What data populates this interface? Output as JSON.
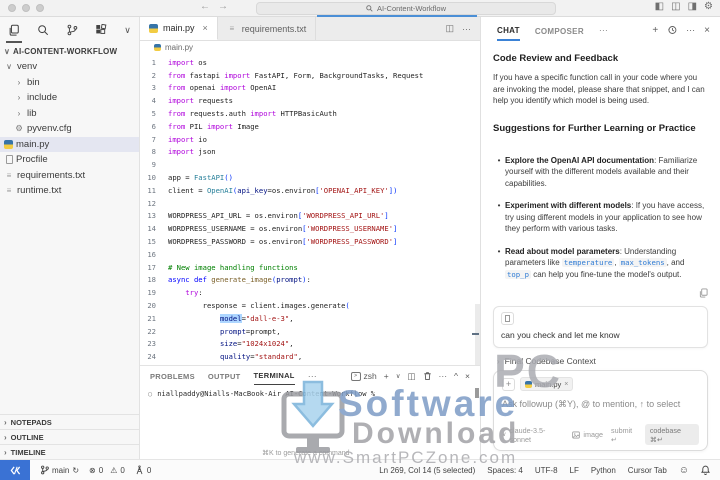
{
  "title_bar": {
    "search_value": "AI-Content-Workflow"
  },
  "icons": {
    "back": "←",
    "forward": "→",
    "panel_left": "◧",
    "panel_bottom": "◫",
    "panel_right": "◨",
    "settings": "⚙",
    "chevron_down": "∨",
    "chevron_right": "›",
    "more": "···",
    "close": "×",
    "plus": "+",
    "split": "◫",
    "caret_up": "^",
    "gear": "⚙",
    "txt_file": "≡",
    "sync": "↻",
    "error": "⊗",
    "warning": "⚠",
    "smiley": "☺",
    "prompt_circle": "○",
    "bullet": "•",
    "enter": "↵",
    "cmd_enter": "⌘↵",
    "shell_glyph": ">"
  },
  "explorer": {
    "root_label": "AI-CONTENT-WORKFLOW",
    "items": [
      {
        "label": "venv",
        "level": 1,
        "chevron": "down"
      },
      {
        "label": "bin",
        "level": 2,
        "chevron": "right"
      },
      {
        "label": "include",
        "level": 2,
        "chevron": "right"
      },
      {
        "label": "lib",
        "level": 2,
        "chevron": "right"
      },
      {
        "label": "pyvenv.cfg",
        "level": 2,
        "icon": "gear"
      },
      {
        "label": "main.py",
        "level": 1,
        "icon": "python",
        "selected": true
      },
      {
        "label": "Procfile",
        "level": 1,
        "icon": "file"
      },
      {
        "label": "requirements.txt",
        "level": 1,
        "icon": "txt"
      },
      {
        "label": "runtime.txt",
        "level": 1,
        "icon": "txt"
      }
    ],
    "bottom_sections": [
      "NOTEPADS",
      "OUTLINE",
      "TIMELINE"
    ]
  },
  "editor": {
    "tabs": [
      {
        "label": "main.py",
        "active": true
      },
      {
        "label": "requirements.txt",
        "active": false
      }
    ],
    "breadcrumb": "main.py",
    "code_lines": [
      {
        "n": 1,
        "tk": [
          [
            "kw",
            "import"
          ],
          [
            "pl",
            " os"
          ]
        ]
      },
      {
        "n": 2,
        "tk": [
          [
            "kw",
            "from"
          ],
          [
            "pl",
            " fastapi "
          ],
          [
            "kw",
            "import"
          ],
          [
            "pl",
            " FastAPI, Form, BackgroundTasks, Request"
          ]
        ]
      },
      {
        "n": 3,
        "tk": [
          [
            "kw",
            "from"
          ],
          [
            "pl",
            " openai "
          ],
          [
            "kw",
            "import"
          ],
          [
            "pl",
            " OpenAI"
          ]
        ]
      },
      {
        "n": 4,
        "tk": [
          [
            "kw",
            "import"
          ],
          [
            "pl",
            " requests"
          ]
        ]
      },
      {
        "n": 5,
        "tk": [
          [
            "kw",
            "from"
          ],
          [
            "pl",
            " requests.auth "
          ],
          [
            "kw",
            "import"
          ],
          [
            "pl",
            " HTTPBasicAuth"
          ]
        ]
      },
      {
        "n": 6,
        "tk": [
          [
            "kw",
            "from"
          ],
          [
            "pl",
            " PIL "
          ],
          [
            "kw",
            "import"
          ],
          [
            "pl",
            " Image"
          ]
        ]
      },
      {
        "n": 7,
        "tk": [
          [
            "kw",
            "import"
          ],
          [
            "pl",
            " io"
          ]
        ]
      },
      {
        "n": 8,
        "tk": [
          [
            "kw",
            "import"
          ],
          [
            "pl",
            " json"
          ]
        ]
      },
      {
        "n": 9,
        "tk": []
      },
      {
        "n": 10,
        "tk": [
          [
            "pl",
            "app = "
          ],
          [
            "cls",
            "FastAPI"
          ],
          [
            "br",
            "()"
          ]
        ]
      },
      {
        "n": 11,
        "tk": [
          [
            "pl",
            "client = "
          ],
          [
            "cls",
            "OpenAI"
          ],
          [
            "br",
            "("
          ],
          [
            "prm",
            "api_key"
          ],
          [
            "pl",
            "=os.environ"
          ],
          [
            "br",
            "["
          ],
          [
            "str",
            "'OPENAI_API_KEY'"
          ],
          [
            "br",
            "]"
          ],
          [
            "br",
            ")"
          ]
        ]
      },
      {
        "n": 12,
        "tk": []
      },
      {
        "n": 13,
        "tk": [
          [
            "pl",
            "WORDPRESS_API_URL = os.environ"
          ],
          [
            "br",
            "["
          ],
          [
            "str",
            "'WORDPRESS_API_URL'"
          ],
          [
            "br",
            "]"
          ]
        ]
      },
      {
        "n": 14,
        "tk": [
          [
            "pl",
            "WORDPRESS_USERNAME = os.environ"
          ],
          [
            "br",
            "["
          ],
          [
            "str",
            "'WORDPRESS_USERNAME'"
          ],
          [
            "br",
            "]"
          ]
        ]
      },
      {
        "n": 15,
        "tk": [
          [
            "pl",
            "WORDPRESS_PASSWORD = os.environ"
          ],
          [
            "br",
            "["
          ],
          [
            "str",
            "'WORDPRESS_PASSWORD'"
          ],
          [
            "br",
            "]"
          ]
        ]
      },
      {
        "n": 16,
        "tk": []
      },
      {
        "n": 17,
        "tk": [
          [
            "com",
            "# New image handling functions"
          ]
        ]
      },
      {
        "n": 18,
        "tk": [
          [
            "kwb",
            "async def"
          ],
          [
            "fn",
            " generate_image"
          ],
          [
            "br",
            "("
          ],
          [
            "prm",
            "prompt"
          ],
          [
            "br",
            ")"
          ],
          [
            "pl",
            ":"
          ]
        ]
      },
      {
        "n": 19,
        "tk": [
          [
            "pl",
            "    "
          ],
          [
            "kw",
            "try"
          ],
          [
            "pl",
            ":"
          ]
        ]
      },
      {
        "n": 20,
        "tk": [
          [
            "pl",
            "        response = client.images.generate"
          ],
          [
            "br",
            "("
          ]
        ]
      },
      {
        "n": 21,
        "tk": [
          [
            "pl",
            "            "
          ],
          [
            "prmsel",
            "model"
          ],
          [
            "pl",
            "="
          ],
          [
            "str",
            "\"dall-e-3\""
          ],
          [
            "pl",
            ","
          ]
        ]
      },
      {
        "n": 22,
        "tk": [
          [
            "pl",
            "            "
          ],
          [
            "prm",
            "prompt"
          ],
          [
            "pl",
            "=prompt,"
          ]
        ]
      },
      {
        "n": 23,
        "tk": [
          [
            "pl",
            "            "
          ],
          [
            "prm",
            "size"
          ],
          [
            "pl",
            "="
          ],
          [
            "str",
            "\"1024x1024\""
          ],
          [
            "pl",
            ","
          ]
        ]
      },
      {
        "n": 24,
        "tk": [
          [
            "pl",
            "            "
          ],
          [
            "prm",
            "quality"
          ],
          [
            "pl",
            "="
          ],
          [
            "str",
            "\"standard\""
          ],
          [
            "pl",
            ","
          ]
        ]
      }
    ]
  },
  "terminal": {
    "tabs": [
      {
        "label": "PROBLEMS",
        "active": false
      },
      {
        "label": "OUTPUT",
        "active": false
      },
      {
        "label": "TERMINAL",
        "active": true
      }
    ],
    "shell_label": "zsh",
    "prompt": "niallpaddy@Nialls-MacBook-Air AI-Content-Workflow %",
    "hint": "⌘K to generate a command"
  },
  "chat": {
    "tabs": [
      {
        "label": "CHAT",
        "active": true
      },
      {
        "label": "COMPOSER",
        "active": false
      }
    ],
    "message": {
      "heading1": "Code Review and Feedback",
      "para": "If you have a specific function call in your code where you are invoking the model, please share that snippet, and I can help you identify which model is being used.",
      "heading2": "Suggestions for Further Learning or Practice",
      "bullets": [
        {
          "segments": [
            {
              "b": "Explore the OpenAI API documentation"
            },
            {
              "t": ": Familiarize yourself with the different models available and their capabilities."
            }
          ]
        },
        {
          "segments": [
            {
              "b": "Experiment with different models"
            },
            {
              "t": ": If you have access, try using different models in your application to see how they perform with various tasks."
            }
          ]
        },
        {
          "segments": [
            {
              "b": "Read about model parameters"
            },
            {
              "t": ": Understanding parameters like "
            },
            {
              "c": "temperature"
            },
            {
              "t": ", "
            },
            {
              "c": "max_tokens"
            },
            {
              "t": ", and "
            },
            {
              "c": "top_p"
            },
            {
              "t": " can help you fine-tune the model's output."
            }
          ]
        }
      ]
    },
    "user_message": "can you check and let me know",
    "context_label": "Final Codebase Context",
    "input": {
      "chip_label": "main.py",
      "placeholder": "Ask followup (⌘Y), @ to mention, ↑ to select",
      "model": "claude-3.5-sonnet",
      "image_label": "image",
      "submit_label": "submit",
      "submit_key": "↵",
      "codebase_label": "codebase",
      "codebase_key": "⌘↵"
    }
  },
  "status_bar": {
    "branch": "main",
    "errors": "0",
    "warnings": "0",
    "ports": "0",
    "cursor": "Ln 269, Col 14 (5 selected)",
    "spaces": "Spaces: 4",
    "encoding": "UTF-8",
    "eol": "LF",
    "language": "Python",
    "tab_label": "Cursor Tab"
  },
  "watermark": {
    "pc": "PC",
    "line1": "Software",
    "line2": "Download",
    "url": "www.SmartPCZone.com"
  },
  "colors": {
    "accent_blue": "#3b82d6",
    "remote_indicator": "#3a72d4",
    "keyword": "#af00db",
    "string": "#a31515",
    "comment": "#008000",
    "selection_highlight": "#add6ff"
  }
}
